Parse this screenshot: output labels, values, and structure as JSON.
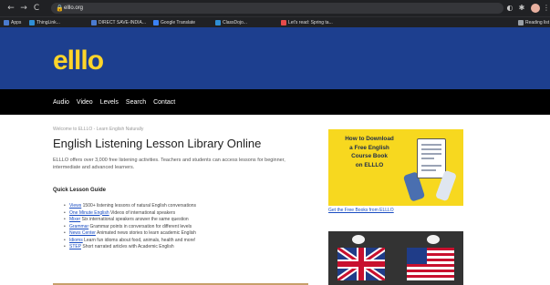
{
  "browser": {
    "nav": {
      "back_icon": "←",
      "forward_icon": "→",
      "reload_icon": "C",
      "home_icon": "⌂"
    },
    "address": {
      "lock_icon": "🔒",
      "url": "elllo.org"
    },
    "bookmarks": [
      {
        "label": "Apps",
        "color": "#4a7bd0"
      },
      {
        "label": "ThingLink...",
        "color": "#2f8fd6"
      },
      {
        "label": "DIRECT SAVE-INDIA...",
        "color": "#4a7bd0"
      },
      {
        "label": "Google Translate",
        "color": "#3b82f6"
      },
      {
        "label": "ClassDojo...",
        "color": "#2f8fd6"
      },
      {
        "label": "Let's read: Spring ta...",
        "color": "#e64a4a"
      }
    ],
    "reading_list": "Reading list"
  },
  "site": {
    "logo": "elllo",
    "colors": {
      "header": "#1d3f8f",
      "nav": "#000000",
      "logo": "#ffd52a",
      "promo": "#f7d81f",
      "link": "#1a4dc2"
    },
    "nav": [
      "Audio",
      "Video",
      "Levels",
      "Search",
      "Contact"
    ]
  },
  "main": {
    "breadcrumb": "Welcome to ELLLO - Learn English Naturally",
    "title": "English Listening Lesson Library Online",
    "intro": "ELLLO offers over 3,000 free listening activities. Teachers and students can access lessons for beginner, intermediate and advanced learners.",
    "quick_guide_heading": "Quick Lesson Guide",
    "guide": [
      {
        "link": "Views",
        "text": " 1500+ listening lessons of natural English conversations"
      },
      {
        "link": "One Minute English",
        "text": " Videos of international speakers"
      },
      {
        "link": "Mixer",
        "text": " Six international speakers answer the same question"
      },
      {
        "link": "Grammar",
        "text": " Grammar points in conversation for different levels"
      },
      {
        "link": "News Center",
        "text": " Animated news stories to learn academic English"
      },
      {
        "link": "Idioms",
        "text": " Learn fun idioms about food, animals, health and more!"
      },
      {
        "link": "STEP",
        "text": " Short narrated articles with Academic English"
      }
    ]
  },
  "sidebar": {
    "promo_text": "How to Download\na Free English\nCourse Book\non ELLLO",
    "promo_link": "Get the Free Books from ELLLO"
  }
}
